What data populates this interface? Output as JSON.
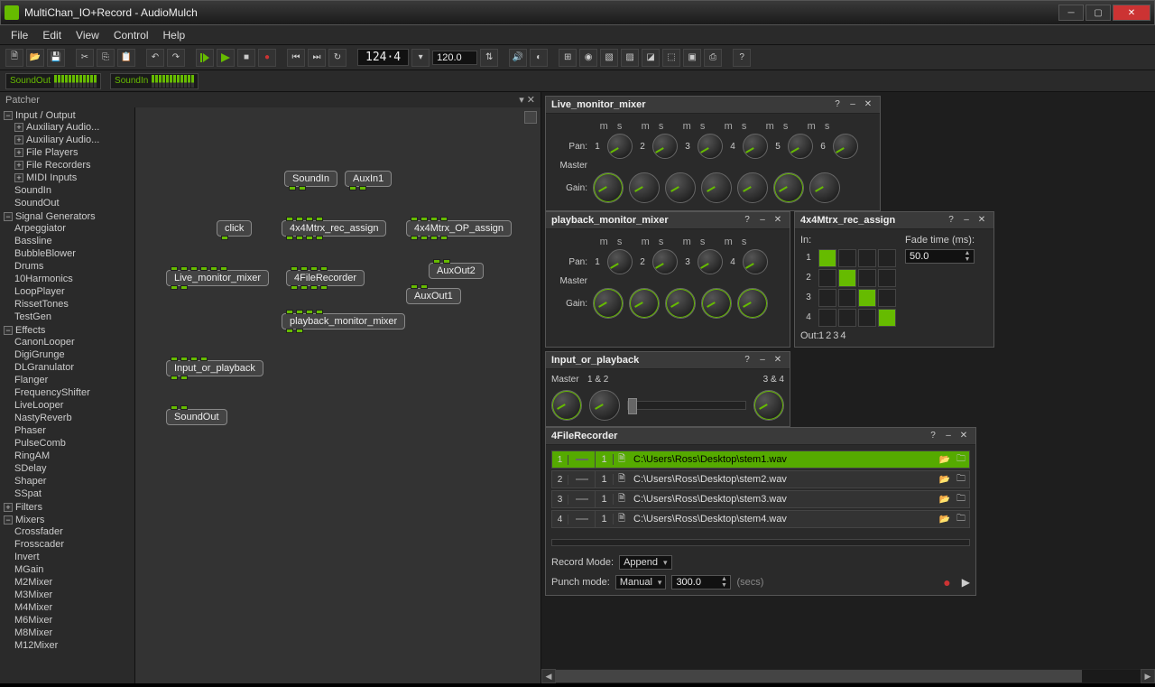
{
  "window": {
    "title": "MultiChan_IO+Record - AudioMulch"
  },
  "menu": [
    "File",
    "Edit",
    "View",
    "Control",
    "Help"
  ],
  "toolbar": {
    "tempo_display": "124·4",
    "tempo_value": "120.0"
  },
  "meters": [
    {
      "label": "SoundOut"
    },
    {
      "label": "SoundIn"
    }
  ],
  "patcher": {
    "title": "Patcher"
  },
  "tree": {
    "io_label": "Input / Output",
    "io": [
      "Auxiliary Audio...",
      "Auxiliary Audio...",
      "File Players",
      "File Recorders",
      "MIDI Inputs",
      "SoundIn",
      "SoundOut"
    ],
    "siggen_label": "Signal Generators",
    "siggen": [
      "Arpeggiator",
      "Bassline",
      "BubbleBlower",
      "Drums",
      "10Harmonics",
      "LoopPlayer",
      "RissetTones",
      "TestGen"
    ],
    "fx_label": "Effects",
    "fx": [
      "CanonLooper",
      "DigiGrunge",
      "DLGranulator",
      "Flanger",
      "FrequencyShifter",
      "LiveLooper",
      "NastyReverb",
      "Phaser",
      "PulseComb",
      "RingAM",
      "SDelay",
      "Shaper",
      "SSpat"
    ],
    "filters_label": "Filters",
    "mixers_label": "Mixers",
    "mixers": [
      "Crossfader",
      "Frosscader",
      "Invert",
      "MGain",
      "M2Mixer",
      "M3Mixer",
      "M4Mixer",
      "M6Mixer",
      "M8Mixer",
      "M12Mixer"
    ]
  },
  "nodes": {
    "soundin": "SoundIn",
    "auxin1": "AuxIn1",
    "click": "click",
    "rec_assign": "4x4Mtrx_rec_assign",
    "op_assign": "4x4Mtrx_OP_assign",
    "live_mixer": "Live_monitor_mixer",
    "filerecorder": "4FileRecorder",
    "auxout2": "AuxOut2",
    "auxout1": "AuxOut1",
    "playback_mixer": "playback_monitor_mixer",
    "input_or_playback": "Input_or_playback",
    "soundout": "SoundOut"
  },
  "panels": {
    "live_mixer": {
      "title": "Live_monitor_mixer",
      "pan": "Pan:",
      "master": "Master",
      "gain": "Gain:",
      "channels": 6,
      "m": "m",
      "s": "s"
    },
    "playback_mixer": {
      "title": "playback_monitor_mixer",
      "pan": "Pan:",
      "master": "Master",
      "gain": "Gain:",
      "channels": 4,
      "m": "m",
      "s": "s"
    },
    "rec_assign": {
      "title": "4x4Mtrx_rec_assign",
      "in": "In:",
      "out": "Out:",
      "fade_label": "Fade time (ms):",
      "fade_value": "50.0",
      "size": 4
    },
    "input_playback": {
      "title": "Input_or_playback",
      "master": "Master",
      "left": "1 & 2",
      "right": "3 & 4"
    },
    "filerecorder": {
      "title": "4FileRecorder",
      "rows": [
        {
          "n": "1",
          "path": "C:\\Users\\Ross\\Desktop\\stem1.wav",
          "sel": true
        },
        {
          "n": "2",
          "path": "C:\\Users\\Ross\\Desktop\\stem2.wav",
          "sel": false
        },
        {
          "n": "3",
          "path": "C:\\Users\\Ross\\Desktop\\stem3.wav",
          "sel": false
        },
        {
          "n": "4",
          "path": "C:\\Users\\Ross\\Desktop\\stem4.wav",
          "sel": false
        }
      ],
      "one": "1",
      "record_mode_label": "Record Mode:",
      "record_mode_value": "Append",
      "punch_mode_label": "Punch mode:",
      "punch_mode_value": "Manual",
      "punch_time": "300.0",
      "secs": "(secs)"
    }
  }
}
